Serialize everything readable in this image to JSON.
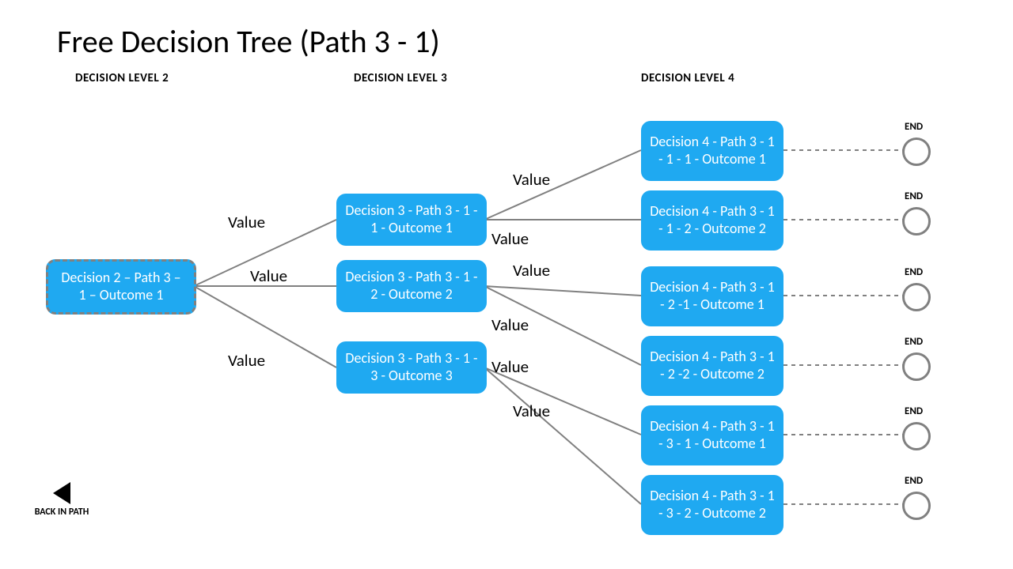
{
  "title": "Free Decision Tree (Path 3 - 1)",
  "column_headers": {
    "level2": "DECISION LEVEL 2",
    "level3": "DECISION LEVEL 3",
    "level4": "DECISION LEVEL 4"
  },
  "nodes": {
    "l2": "Decision 2 – Path 3 – 1 – Outcome 1",
    "l3a": "Decision 3 - Path 3 - 1 - 1 - Outcome 1",
    "l3b": "Decision 3 - Path 3 - 1 - 2 - Outcome 2",
    "l3c": "Decision 3 - Path 3 - 1 - 3 - Outcome 3",
    "l4a": "Decision 4 - Path 3 - 1 - 1 - 1 - Outcome 1",
    "l4b": "Decision 4 - Path 3 - 1 - 1 - 2 - Outcome 2",
    "l4c": "Decision 4 - Path 3 - 1 - 2 -1 - Outcome 1",
    "l4d": "Decision 4 - Path 3 - 1 - 2 -2 - Outcome 2",
    "l4e": "Decision 4 - Path 3 - 1 - 3 - 1 - Outcome 1",
    "l4f": "Decision 4 - Path 3 - 1 - 3 - 2 - Outcome 2"
  },
  "edge_label": "Value",
  "end_label": "END",
  "back_label": "BACK IN PATH",
  "chart_data": {
    "type": "tree",
    "root": {
      "id": "d2",
      "label": "Decision 2 – Path 3 – 1 – Outcome 1",
      "children": [
        {
          "id": "d3a",
          "label": "Decision 3 - Path 3 - 1 - 1 - Outcome 1",
          "edge": "Value",
          "children": [
            {
              "id": "d4a",
              "label": "Decision 4 - Path 3 - 1 - 1 - 1 - Outcome 1",
              "edge": "Value",
              "end": true
            },
            {
              "id": "d4b",
              "label": "Decision 4 - Path 3 - 1 - 1 - 2 - Outcome 2",
              "edge": "Value",
              "end": true
            }
          ]
        },
        {
          "id": "d3b",
          "label": "Decision 3 - Path 3 - 1 - 2 - Outcome 2",
          "edge": "Value",
          "children": [
            {
              "id": "d4c",
              "label": "Decision 4 - Path 3 - 1 - 2 -1 - Outcome 1",
              "edge": "Value",
              "end": true
            },
            {
              "id": "d4d",
              "label": "Decision 4 - Path 3 - 1 - 2 -2 - Outcome 2",
              "edge": "Value",
              "end": true
            }
          ]
        },
        {
          "id": "d3c",
          "label": "Decision 3 - Path 3 - 1 - 3 - Outcome 3",
          "edge": "Value",
          "children": [
            {
              "id": "d4e",
              "label": "Decision 4 - Path 3 - 1 - 3 - 1 - Outcome 1",
              "edge": "Value",
              "end": true
            },
            {
              "id": "d4f",
              "label": "Decision 4 - Path 3 - 1 - 3 - 2 - Outcome 2",
              "edge": "Value",
              "end": true
            }
          ]
        }
      ]
    }
  }
}
